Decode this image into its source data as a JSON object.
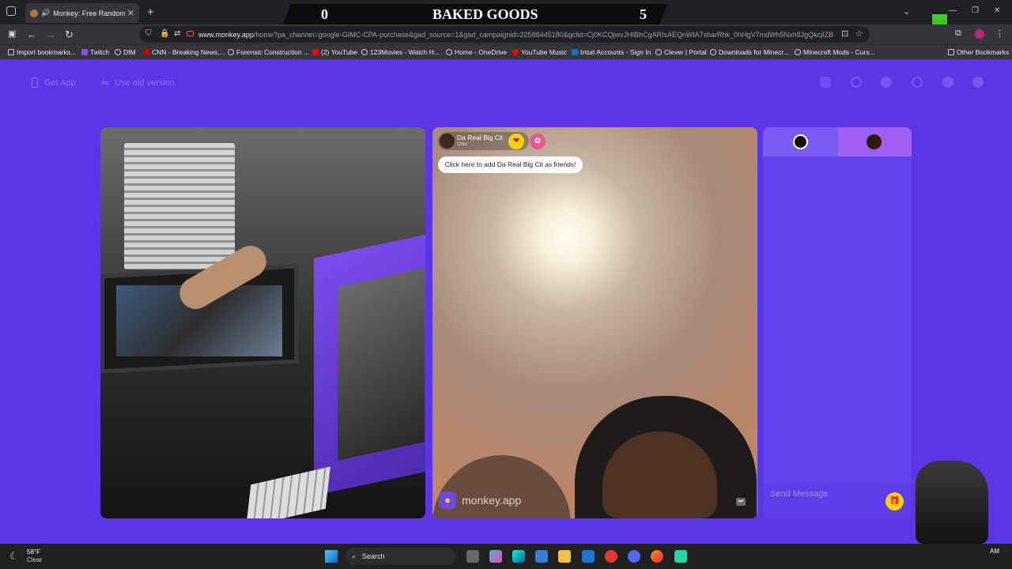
{
  "browser": {
    "tab_title": "Monkey: Free Random Vide",
    "url_host": "www.monkey.app",
    "url_path": "/home?pa_channel=google-GIMC-CPA-purchase&gad_source=1&gad_campaignid=22588445180&gclid=Cj0KCQjwvJHIBhCgARIsAEQnWlA7sharRhk_0hHgV7mdWh5Nxh8JgQkcjIZB",
    "bookmarks": [
      "Import bookmarks...",
      "Twitch",
      "DIM",
      "CNN - Breaking News,...",
      "Forensic Construction ...",
      "(2) YouTube",
      "123Movies - Watch H...",
      "Home - OneDrive",
      "YouTube Music",
      "Intuit Accounts - Sign In",
      "Clever | Portal",
      "Downloads for Minecr...",
      "Minecraft Mods - Curs..."
    ],
    "other_bookmarks": "Other Bookmarks"
  },
  "score_overlay": {
    "left_score": "0",
    "title": "BAKED GOODS",
    "right_score": "5"
  },
  "page": {
    "get_app": "Get App",
    "use_old_version": "Use old version",
    "partner": {
      "name": "Da Real Big Cit",
      "location": "Ohio",
      "friend_tooltip": "Click here to add Da Real Big Cit as friends!"
    },
    "watermark": "monkey.app",
    "chat": {
      "placeholder": "Send Message"
    }
  },
  "taskbar": {
    "weather_temp": "58°F",
    "weather_desc": "Clear",
    "search_label": "Search",
    "time_partial": "AM"
  },
  "colors": {
    "page_bg": "#5b35e6",
    "chat_bg": "#6442ee",
    "accent_yellow": "#f5d20f"
  }
}
